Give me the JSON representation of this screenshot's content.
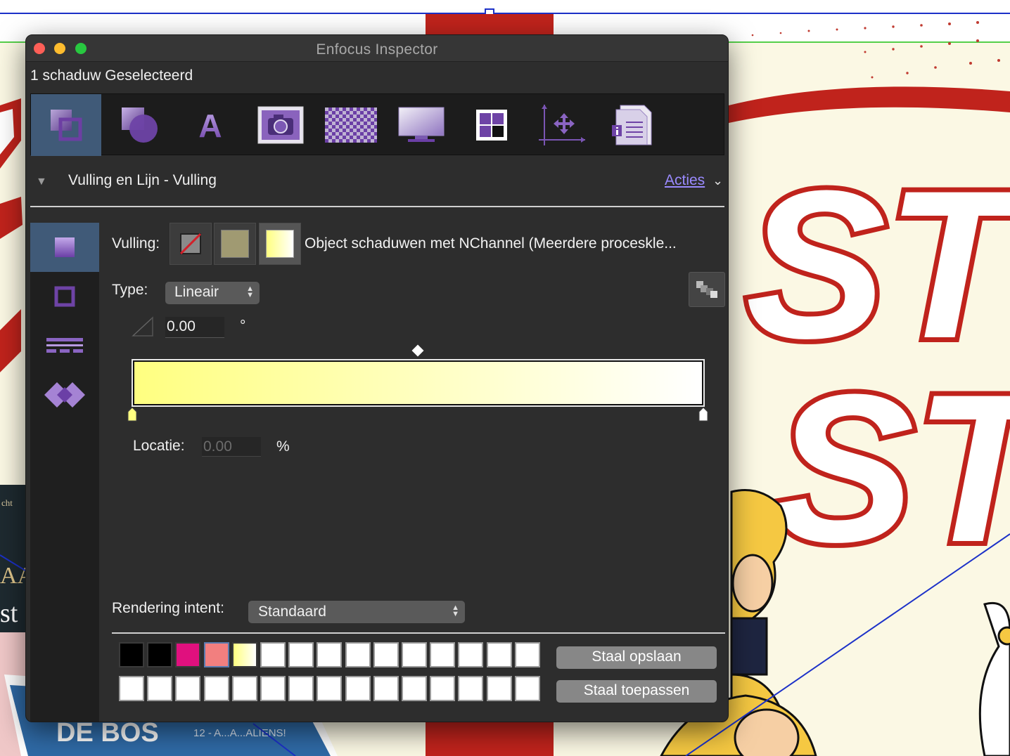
{
  "window": {
    "title": "Enfocus Inspector"
  },
  "selection_label": "1 schaduw Geselecteerd",
  "toolbar": {
    "items": [
      {
        "icon": "fill-stroke-icon",
        "active": true
      },
      {
        "icon": "shapes-icon",
        "active": false
      },
      {
        "icon": "text-icon",
        "active": false
      },
      {
        "icon": "camera-icon",
        "active": false
      },
      {
        "icon": "transparency-icon",
        "active": false
      },
      {
        "icon": "monitor-icon",
        "active": false
      },
      {
        "icon": "color-swatches-icon",
        "active": false
      },
      {
        "icon": "position-icon",
        "active": false
      },
      {
        "icon": "document-info-icon",
        "active": false
      }
    ],
    "text_icon_glyph": "A"
  },
  "section": {
    "title": "Vulling en Lijn - Vulling",
    "actions_label": "Acties"
  },
  "sidetabs": [
    {
      "icon": "fill-square-icon",
      "active": true
    },
    {
      "icon": "stroke-square-icon",
      "active": false
    },
    {
      "icon": "dash-pattern-icon",
      "active": false
    },
    {
      "icon": "join-overlap-icon",
      "active": false
    }
  ],
  "fill": {
    "label": "Vulling:",
    "name": "Object schaduwen met NChannel (Meerdere proceskle...",
    "solid_swatch_color": "#a09a72"
  },
  "type": {
    "label": "Type:",
    "value": "Lineair"
  },
  "angle": {
    "value": "0.00",
    "unit": "°"
  },
  "gradient": {
    "start_color": "#ffff80",
    "end_color": "#ffffff"
  },
  "location": {
    "label": "Locatie:",
    "value": "0.00",
    "unit": "%"
  },
  "rendering_intent": {
    "label": "Rendering intent:",
    "value": "Standaard"
  },
  "swatches": {
    "row1": [
      "#000000",
      "#000000",
      "#e0107e",
      "#f27f7f",
      "gradient",
      "#ffffff",
      "#ffffff",
      "#ffffff",
      "#ffffff",
      "#ffffff",
      "#ffffff",
      "#ffffff",
      "#ffffff",
      "#ffffff",
      "#ffffff"
    ],
    "row2": [
      "#ffffff",
      "#ffffff",
      "#ffffff",
      "#ffffff",
      "#ffffff",
      "#ffffff",
      "#ffffff",
      "#ffffff",
      "#ffffff",
      "#ffffff",
      "#ffffff",
      "#ffffff",
      "#ffffff",
      "#ffffff",
      "#ffffff"
    ],
    "picked_index": 3
  },
  "buttons": {
    "save": "Staal opslaan",
    "apply": "Staal toepassen"
  },
  "background": {
    "bottom_label": "12 - A...A...ALIENS!",
    "cover_letters": "DE BOS",
    "headline_top": "STR",
    "headline_bottom": "ST",
    "side_text_1": "cht",
    "side_text_2": "st",
    "side_text_3": "AA"
  }
}
